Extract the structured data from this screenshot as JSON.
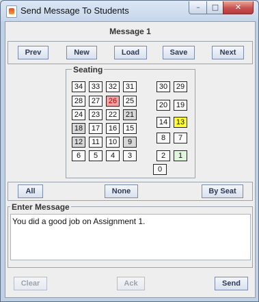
{
  "window": {
    "title": "Send Message To Students"
  },
  "header": {
    "title": "Message 1"
  },
  "toolbar": {
    "prev": "Prev",
    "new": "New",
    "load": "Load",
    "save": "Save",
    "next": "Next"
  },
  "seating": {
    "title": "Seating",
    "seats": [
      {
        "label": "34",
        "state": "white"
      },
      {
        "label": "33",
        "state": "white"
      },
      {
        "label": "32",
        "state": "white"
      },
      {
        "label": "31",
        "state": "white"
      },
      {
        "label": "28",
        "state": "white"
      },
      {
        "label": "27",
        "state": "white"
      },
      {
        "label": "26",
        "state": "red"
      },
      {
        "label": "25",
        "state": "white"
      },
      {
        "label": "24",
        "state": "white"
      },
      {
        "label": "23",
        "state": "white"
      },
      {
        "label": "22",
        "state": "white"
      },
      {
        "label": "21",
        "state": "gray"
      },
      {
        "label": "18",
        "state": "gray"
      },
      {
        "label": "17",
        "state": "white"
      },
      {
        "label": "16",
        "state": "white"
      },
      {
        "label": "15",
        "state": "white"
      },
      {
        "label": "12",
        "state": "gray"
      },
      {
        "label": "11",
        "state": "white"
      },
      {
        "label": "10",
        "state": "white"
      },
      {
        "label": "9",
        "state": "gray"
      },
      {
        "label": "6",
        "state": "white"
      },
      {
        "label": "5",
        "state": "white"
      },
      {
        "label": "4",
        "state": "white"
      },
      {
        "label": "3",
        "state": "white"
      },
      {
        "label": "30",
        "state": "white"
      },
      {
        "label": "29",
        "state": "white"
      },
      {
        "label": "20",
        "state": "white"
      },
      {
        "label": "19",
        "state": "white"
      },
      {
        "label": "14",
        "state": "white"
      },
      {
        "label": "13",
        "state": "yellow"
      },
      {
        "label": "8",
        "state": "white"
      },
      {
        "label": "7",
        "state": "white"
      },
      {
        "label": "2",
        "state": "white"
      },
      {
        "label": "1",
        "state": "green"
      },
      {
        "label": "0",
        "state": "white"
      }
    ]
  },
  "selection": {
    "all": "All",
    "none": "None",
    "by_seat": "By Seat"
  },
  "message": {
    "title": "Enter Message",
    "text": "You did a good job on Assignment 1."
  },
  "footer": {
    "clear": "Clear",
    "ack": "Ack",
    "send": "Send"
  },
  "colors": {
    "red_seat": "#f2a3a3",
    "yellow_seat": "#ffff33",
    "green_seat": "#dff5dc",
    "gray_seat": "#d8d8d8"
  }
}
